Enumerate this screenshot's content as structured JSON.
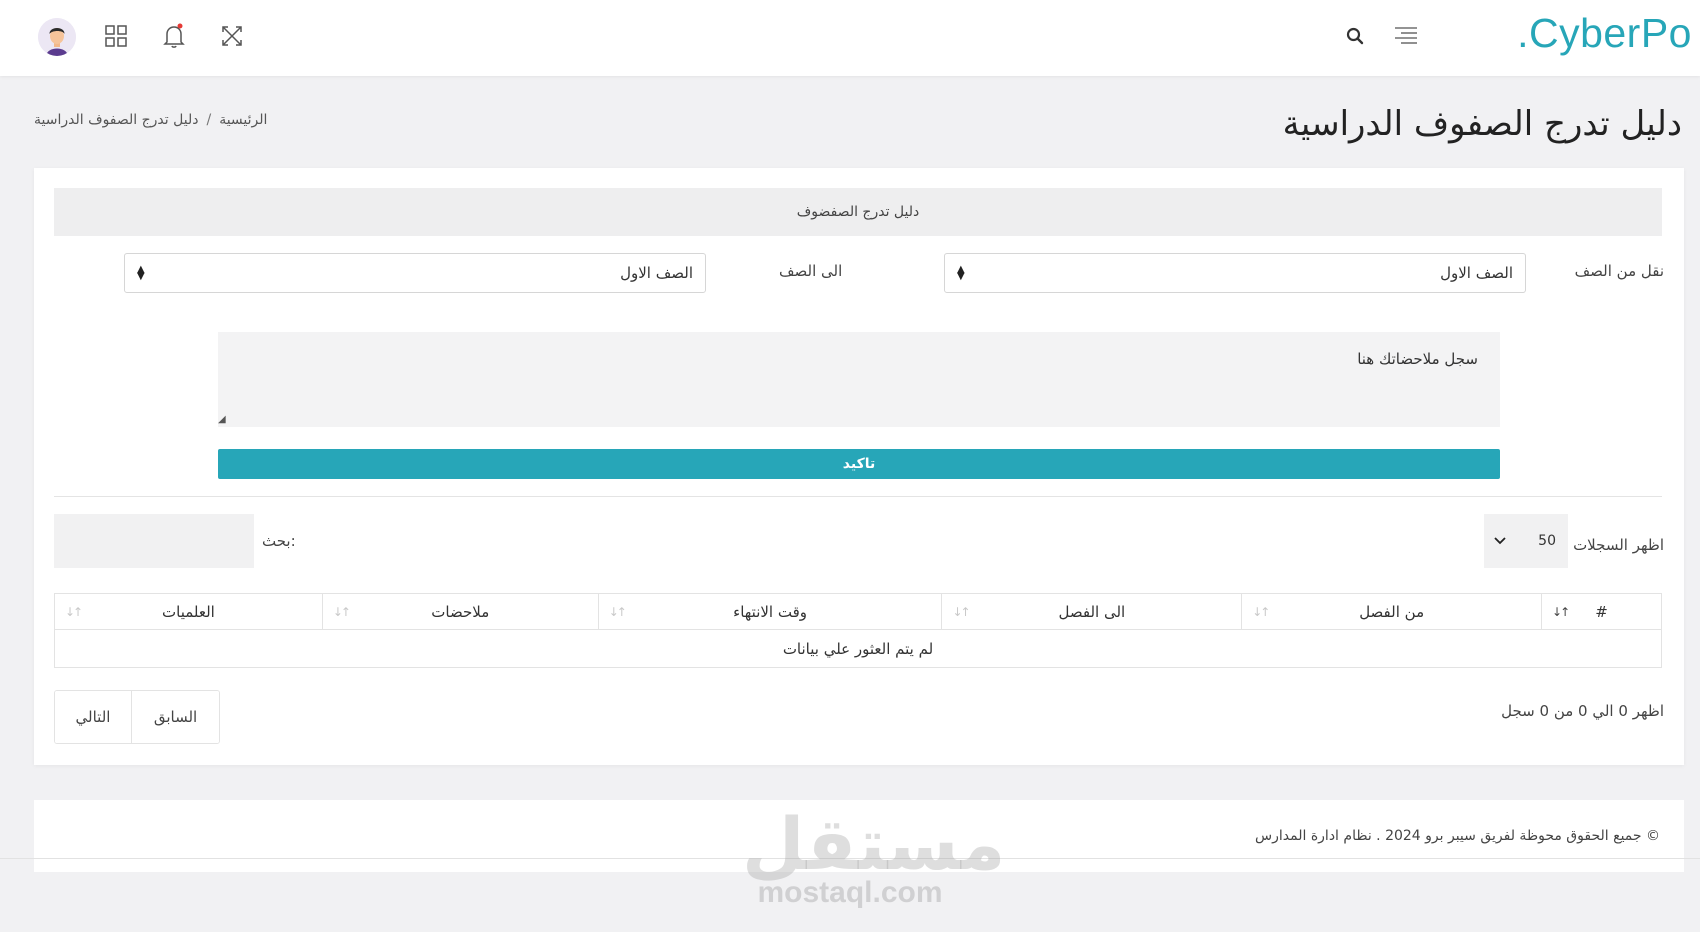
{
  "navbar": {
    "brand": ".CyberPo",
    "icons": [
      "search-icon",
      "menu-icon",
      "fullscreen-icon",
      "bell-icon",
      "apps-grid-icon",
      "avatar"
    ],
    "accent_color": "#27a6b8"
  },
  "header": {
    "title": "دليل تدرج الصفوف الدراسية",
    "breadcrumb": [
      "الرئيسية",
      "دليل تدرج الصفوف الدراسية"
    ],
    "breadcrumb_separator": "/"
  },
  "form": {
    "card_title": "دليل تدرج الصفضوف",
    "from_label": "نقل من الصف",
    "from_value": "الصف الاول",
    "to_label": "الى الصف",
    "to_value": "الصف الاول",
    "notes_placeholder": "سجل ملاحضاتك هنا",
    "confirm_label": "تاكيد"
  },
  "table_controls": {
    "length_label": "اظهر السجلات",
    "length_value": "50",
    "search_label": "بحث:"
  },
  "table": {
    "columns": [
      "#",
      "من الفصل",
      "الى الفصل",
      "وقت الانتهاء",
      "ملاحضات",
      "العلميات"
    ],
    "empty_text": "لم يتم العثور علي بيانات"
  },
  "pagination": {
    "info": "اظهر 0 الي 0 من 0 سجل",
    "prev_label": "السابق",
    "next_label": "التالي"
  },
  "footer": {
    "text": "© جميع الحقوق محوظة لفريق سيبر برو 2024 . نظام ادارة المدارس"
  },
  "watermark": {
    "arabic": "مستقل",
    "latin": "mostaql.com"
  }
}
